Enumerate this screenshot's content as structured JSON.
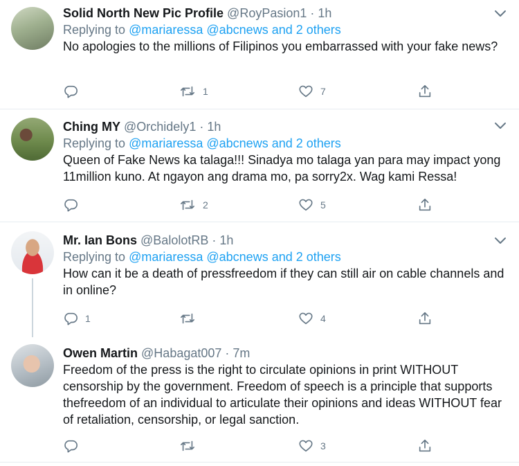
{
  "icons": {
    "reply": "reply-icon",
    "retweet": "retweet-icon",
    "like": "heart-icon",
    "share": "share-icon",
    "more": "chevron-down-icon"
  },
  "colors": {
    "text": "#14171a",
    "muted": "#657786",
    "link": "#1da1f2",
    "divider": "#e6ecf0",
    "thread_line": "#ccd6dd"
  },
  "tweets": [
    {
      "name": "Solid North New Pic Profile",
      "handle": "@RoyPasion1",
      "dot": "·",
      "time": "1h",
      "replying_prefix": "Replying to",
      "replying_to": "@mariaressa @abcnews and 2 others",
      "text": "No apologies to the millions of Filipinos you embarrassed with your fake news?",
      "replies": "",
      "retweets": "1",
      "likes": "7"
    },
    {
      "name": "Ching MY",
      "handle": "@Orchidely1",
      "dot": "·",
      "time": "1h",
      "replying_prefix": "Replying to",
      "replying_to": "@mariaressa @abcnews and 2 others",
      "text": "Queen of Fake News ka talaga!!! Sinadya mo talaga yan para may impact yong 11million kuno. At ngayon ang drama mo, pa sorry2x. Wag kami Ressa!",
      "replies": "",
      "retweets": "2",
      "likes": "5"
    },
    {
      "name": "Mr. Ian Bons",
      "handle": "@BalolotRB",
      "dot": "·",
      "time": "1h",
      "replying_prefix": "Replying to",
      "replying_to": "@mariaressa @abcnews and 2 others",
      "text": "How can it be a death of pressfreedom if they can still air on cable channels and in online?",
      "replies": "1",
      "retweets": "",
      "likes": "4"
    },
    {
      "name": "Owen Martin",
      "handle": "@Habagat007",
      "dot": "·",
      "time": "7m",
      "text": "Freedom of the press is the right to circulate opinions in print WITHOUT censorship by the government. Freedom of speech is a principle that supports thefreedom of an individual to articulate their opinions and ideas WITHOUT fear of retaliation, censorship, or legal sanction.",
      "replies": "",
      "retweets": "",
      "likes": "3"
    }
  ]
}
